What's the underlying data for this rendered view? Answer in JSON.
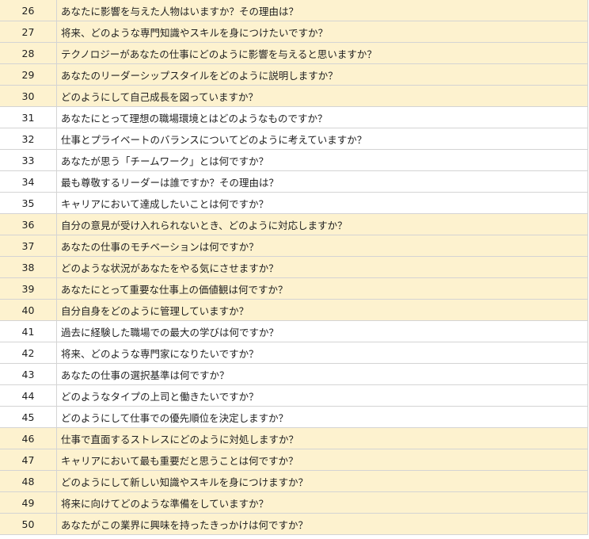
{
  "rows": [
    {
      "no": "26",
      "question": "あなたに影響を与えた人物はいますか？その理由は？",
      "highlight": true
    },
    {
      "no": "27",
      "question": "将来、どのような専門知識やスキルを身につけたいですか？",
      "highlight": true
    },
    {
      "no": "28",
      "question": "テクノロジーがあなたの仕事にどのように影響を与えると思いますか？",
      "highlight": true
    },
    {
      "no": "29",
      "question": "あなたのリーダーシップスタイルをどのように説明しますか？",
      "highlight": true
    },
    {
      "no": "30",
      "question": "どのようにして自己成長を図っていますか？",
      "highlight": true
    },
    {
      "no": "31",
      "question": "あなたにとって理想の職場環境とはどのようなものですか？",
      "highlight": false
    },
    {
      "no": "32",
      "question": "仕事とプライベートのバランスについてどのように考えていますか？",
      "highlight": false
    },
    {
      "no": "33",
      "question": "あなたが思う「チームワーク」とは何ですか？",
      "highlight": false
    },
    {
      "no": "34",
      "question": "最も尊敬するリーダーは誰ですか？その理由は？",
      "highlight": false
    },
    {
      "no": "35",
      "question": "キャリアにおいて達成したいことは何ですか？",
      "highlight": false
    },
    {
      "no": "36",
      "question": "自分の意見が受け入れられないとき、どのように対応しますか？",
      "highlight": true
    },
    {
      "no": "37",
      "question": "あなたの仕事のモチベーションは何ですか？",
      "highlight": true
    },
    {
      "no": "38",
      "question": "どのような状況があなたをやる気にさせますか？",
      "highlight": true
    },
    {
      "no": "39",
      "question": "あなたにとって重要な仕事上の価値観は何ですか？",
      "highlight": true
    },
    {
      "no": "40",
      "question": "自分自身をどのように管理していますか？",
      "highlight": true
    },
    {
      "no": "41",
      "question": "過去に経験した職場での最大の学びは何ですか？",
      "highlight": false
    },
    {
      "no": "42",
      "question": "将来、どのような専門家になりたいですか？",
      "highlight": false
    },
    {
      "no": "43",
      "question": "あなたの仕事の選択基準は何ですか？",
      "highlight": false
    },
    {
      "no": "44",
      "question": "どのようなタイプの上司と働きたいですか？",
      "highlight": false
    },
    {
      "no": "45",
      "question": "どのようにして仕事での優先順位を決定しますか？",
      "highlight": false
    },
    {
      "no": "46",
      "question": "仕事で直面するストレスにどのように対処しますか？",
      "highlight": true
    },
    {
      "no": "47",
      "question": "キャリアにおいて最も重要だと思うことは何ですか？",
      "highlight": true
    },
    {
      "no": "48",
      "question": "どのようにして新しい知識やスキルを身につけますか？",
      "highlight": true
    },
    {
      "no": "49",
      "question": "将来に向けてどのような準備をしていますか？",
      "highlight": true
    },
    {
      "no": "50",
      "question": "あなたがこの業界に興味を持ったきっかけは何ですか？",
      "highlight": true
    }
  ],
  "colors": {
    "highlight": "#fdf2cf",
    "plain": "#ffffff",
    "gridline": "#d4d4d4"
  }
}
